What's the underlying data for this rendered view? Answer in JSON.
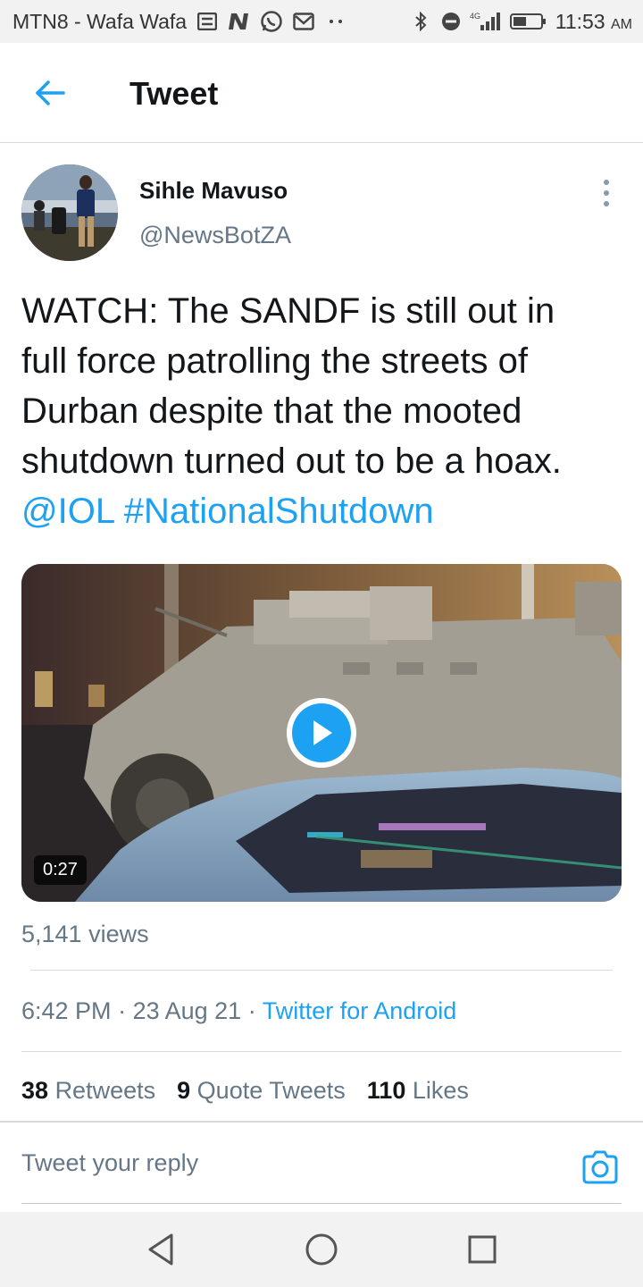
{
  "status_bar": {
    "carrier": "MTN8 - Wafa Wafa",
    "network": "4G",
    "time": "11:53",
    "ampm": "AM"
  },
  "header": {
    "title": "Tweet"
  },
  "tweet": {
    "author_name": "Sihle Mavuso",
    "author_handle": "@NewsBotZA",
    "text_lines": [
      "WATCH: The SANDF is still out in",
      "full force patrolling the streets of",
      "Durban despite that the mooted",
      "shutdown turned out to be a hoax."
    ],
    "mention": "@IOL",
    "hashtag": "#NationalShutdown",
    "video_duration": "0:27",
    "views": "5,141 views",
    "time": "6:42 PM",
    "date": "23 Aug 21",
    "source": "Twitter for Android"
  },
  "stats": {
    "retweets_count": "38",
    "retweets_label": "Retweets",
    "quotes_count": "9",
    "quotes_label": "Quote Tweets",
    "likes_count": "110",
    "likes_label": "Likes"
  },
  "reply": {
    "placeholder": "Tweet your reply"
  },
  "colors": {
    "accent": "#1da1f2",
    "text": "#14171a",
    "secondary": "#657786"
  },
  "icons": {
    "back": "arrow-left-icon",
    "more": "kebab-menu-icon",
    "play": "play-icon",
    "camera": "camera-icon",
    "nav_back": "triangle-back-icon",
    "nav_home": "circle-home-icon",
    "nav_recents": "square-recents-icon"
  }
}
